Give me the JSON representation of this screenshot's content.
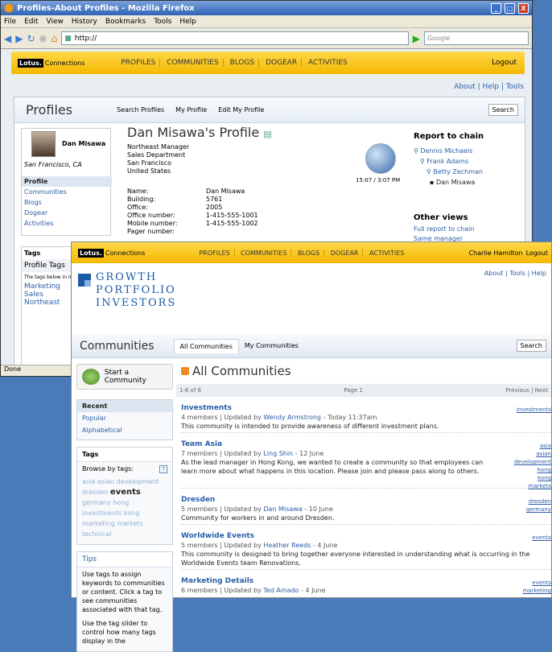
{
  "window": {
    "title": "Profiles-About Profiles - Mozilla Firefox",
    "min": "_",
    "max": "□",
    "close": "X"
  },
  "menu": [
    "File",
    "Edit",
    "View",
    "History",
    "Bookmarks",
    "Tools",
    "Help"
  ],
  "nav": {
    "url": "http://",
    "search_placeholder": "Google"
  },
  "lotus": {
    "logo": "Lotus.",
    "brand": "Connections",
    "links": [
      "PROFILES",
      "COMMUNITIES",
      "BLOGS",
      "DOGEAR",
      "ACTIVITIES"
    ],
    "logout": "Logout"
  },
  "toplinks": "About | Help | Tools",
  "profiles": {
    "title": "Profiles",
    "tabs": [
      "Search Profiles",
      "My Profile",
      "Edit My Profile"
    ],
    "search": "Search",
    "name": "Dan Misawa",
    "location": "San Francisco, CA",
    "menu": [
      "Profile",
      "Communities",
      "Blogs",
      "Dogear",
      "Activities"
    ],
    "tags_title": "Tags",
    "tags_sub": "Profile Tags",
    "tags_note": "The tags below in interests",
    "tags": [
      "Marketing",
      "Sales",
      "Northeast"
    ],
    "profile_title": "Dan Misawa's Profile",
    "info": [
      "Northeast Manager",
      "Sales Department",
      "San Francisco",
      "United States"
    ],
    "time": "15:07 / 3:07 PM",
    "details": [
      {
        "k": "Name:",
        "v": "Dan Misawa"
      },
      {
        "k": "Building:",
        "v": "5761"
      },
      {
        "k": "Office:",
        "v": "2005"
      },
      {
        "k": "Office number:",
        "v": "1-415-555-1001"
      },
      {
        "k": "Mobile number:",
        "v": "1-415-555-1002"
      },
      {
        "k": "Pager number:",
        "v": ""
      }
    ],
    "chain_title": "Report to chain",
    "chain": [
      "Dennis Michaels",
      "Frank Adams",
      "Betty Zechman",
      "Dan Misawa"
    ],
    "other_title": "Other views",
    "other": [
      "Full report to chain",
      "Same manager"
    ]
  },
  "status": "Done",
  "communities": {
    "user": "Charlie Hamilton",
    "logout": "Logout",
    "brand_lines": [
      "GROWTH",
      "PORTFOLIO",
      "INVESTORS"
    ],
    "toplinks": "About | Tools | Help",
    "title": "Communities",
    "tabs": [
      "All Communities",
      "My Communities"
    ],
    "search": "Search",
    "start": "Start a Community",
    "menu": [
      "Recent",
      "Popular",
      "Alphabetical"
    ],
    "tags_title": "Tags",
    "browse": "Browse by tags:",
    "help": "?",
    "cloud_before": "asia asian development dresden",
    "cloud_big": "events",
    "cloud_after": "germany hong investments kong marketing markets technical",
    "tips_title": "Tips",
    "tips": [
      "Use tags to assign keywords to communities or content. Click a tag to see communities associated with that tag.",
      "Use the tag slider to control how many tags display in the"
    ],
    "heading": "All Communities",
    "range": "1-6 of 6",
    "page": "Page 1",
    "pager": "Previous | Next",
    "items": [
      {
        "title": "Investments",
        "members": "4 members",
        "by": "Wendy Armstrong",
        "when": "Today 11:37am",
        "desc": "This community is intended to provide awareness of different investment plans.",
        "tags": "investments"
      },
      {
        "title": "Team Asia",
        "members": "7 members",
        "by": "Ling Shin",
        "when": "12 June",
        "desc": "As the lead manager in Hong Kong, we wanted to create a community so that employees can learn more about what happens in this location.  Please join and please pass along to others.",
        "tags": "asia\nasian\ndevelopment\nhong\nkong\nmarkets"
      },
      {
        "title": "Dresden",
        "members": "5 members",
        "by": "Dan Misawa",
        "when": "10 June",
        "desc": "Community for workers in and around Dresden.",
        "tags": "dresden\ngermany"
      },
      {
        "title": "Worldwide Events",
        "members": "5 members",
        "by": "Heather Reeds",
        "when": "4 June",
        "desc": "This community is designed to bring together everyone interested in understanding what is occurring in the Worldwide Events team Renovations.",
        "tags": "events"
      },
      {
        "title": "Marketing Details",
        "members": "6 members",
        "by": "Ted Amado",
        "when": "4 June",
        "desc": "",
        "tags": "events\nmarketing"
      }
    ]
  }
}
